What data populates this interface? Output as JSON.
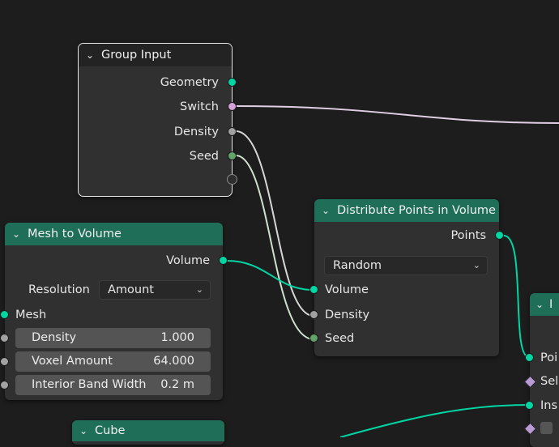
{
  "nodes": {
    "group_input": {
      "title": "Group Input",
      "outputs": [
        "Geometry",
        "Switch",
        "Density",
        "Seed"
      ]
    },
    "mesh_to_volume": {
      "title": "Mesh to Volume",
      "output": "Volume",
      "resolution_label": "Resolution",
      "resolution_value": "Amount",
      "input_mesh": "Mesh",
      "fields": [
        {
          "label": "Density",
          "value": "1.000"
        },
        {
          "label": "Voxel Amount",
          "value": "64.000"
        },
        {
          "label": "Interior Band Width",
          "value": "0.2 m"
        }
      ]
    },
    "distribute_points": {
      "title": "Distribute Points in Volume",
      "output": "Points",
      "mode_value": "Random",
      "inputs": [
        "Volume",
        "Density",
        "Seed"
      ]
    },
    "cube": {
      "title": "Cube"
    },
    "partial_node": {
      "title": "I",
      "inputs": [
        "Poi",
        "Sel",
        "Ins"
      ]
    }
  },
  "colors": {
    "geometry_socket": "#00d6a3",
    "boolean_socket": "#d2a2d8",
    "float_socket": "#a1a1a1",
    "integer_socket": "#62a36a",
    "geometry_header": "#1e6e58",
    "group_input_header": "#232323",
    "background": "#1d1d1d"
  }
}
